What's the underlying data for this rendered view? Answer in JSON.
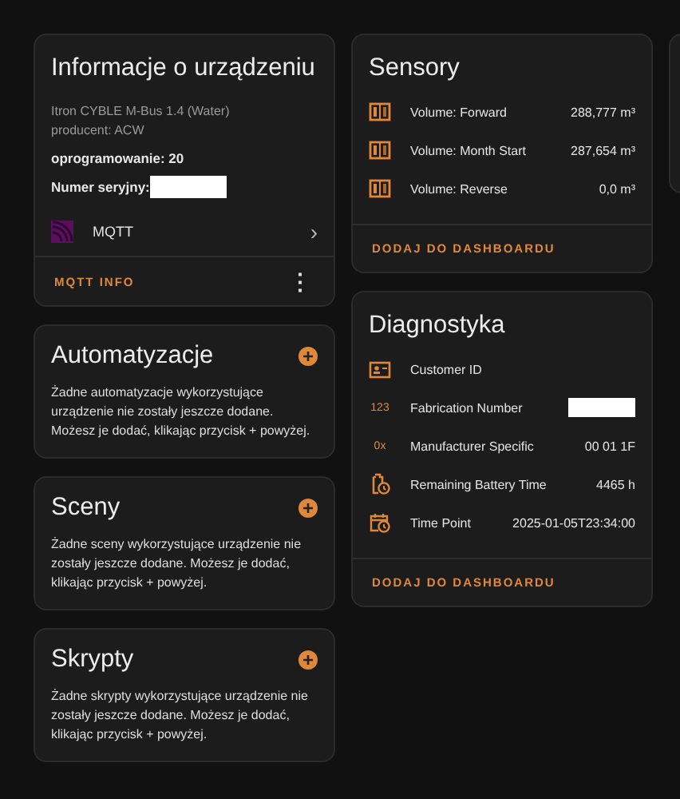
{
  "device_info": {
    "title": "Informacje o urządzeniu",
    "model": "Itron CYBLE M-Bus 1.4 (Water)",
    "manufacturer": "producent: ACW",
    "firmware": "oprogramowanie: 20",
    "serial_label": "Numer seryjny:",
    "serial_redacted": true,
    "integration": {
      "name": "MQTT",
      "chevron": "›"
    },
    "action": "MQTT INFO",
    "menu": "⋮"
  },
  "related": [
    {
      "title": "Automatyzacje",
      "text": "Żadne automatyzacje wykorzystujące urządzenie nie zostały jeszcze dodane. Możesz je dodać, klikając przycisk + powyżej."
    },
    {
      "title": "Sceny",
      "text": "Żadne sceny wykorzystujące urządzenie nie zostały jeszcze dodane. Możesz je dodać, klikając przycisk + powyżej."
    },
    {
      "title": "Skrypty",
      "text": "Żadne skrypty wykorzystujące urządzenie nie zostały jeszcze dodane. Możesz je dodać, klikając przycisk + powyżej."
    }
  ],
  "sensors": {
    "title": "Sensory",
    "rows": [
      {
        "kind": "counter",
        "name": "Volume: Forward",
        "value": "288,777 m³"
      },
      {
        "kind": "counter",
        "name": "Volume: Month Start",
        "value": "287,654 m³"
      },
      {
        "kind": "counter",
        "name": "Volume: Reverse",
        "value": "0,0 m³"
      }
    ],
    "action": "DODAJ DO DASHBOARDU"
  },
  "diagnostics": {
    "title": "Diagnostyka",
    "rows": [
      {
        "kind": "card",
        "name": "Customer ID"
      },
      {
        "kind": "text",
        "icon_text": "123",
        "name": "Fabrication Number",
        "redacted": true
      },
      {
        "kind": "text",
        "icon_text": "0x",
        "name": "Manufacturer Specific",
        "value": "00 01 1F"
      },
      {
        "kind": "battery",
        "name": "Remaining Battery Time",
        "value": "4465 h"
      },
      {
        "kind": "calendar",
        "name": "Time Point",
        "value": "2025-01-05T23:34:00"
      }
    ],
    "action": "DODAJ DO DASHBOARDU"
  }
}
